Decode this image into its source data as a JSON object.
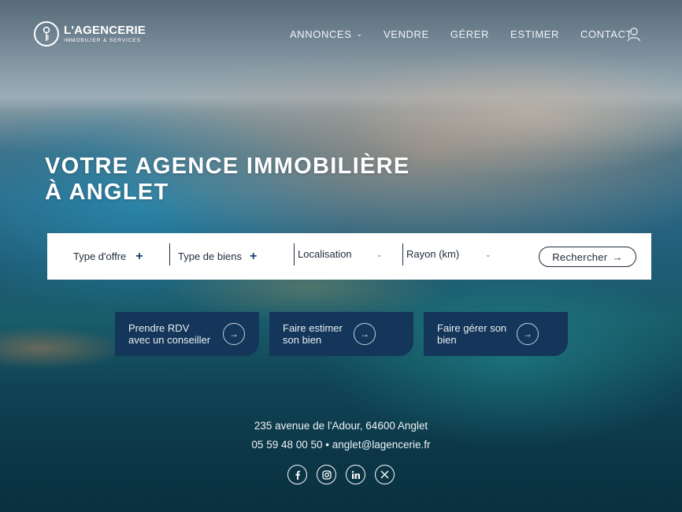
{
  "brand": {
    "name": "L'AGENCERIE",
    "tagline": "IMMOBILIER & SERVICES"
  },
  "nav": {
    "items": [
      {
        "label": "ANNONCES",
        "has_dropdown": true
      },
      {
        "label": "VENDRE"
      },
      {
        "label": "GÉRER"
      },
      {
        "label": "ESTIMER"
      },
      {
        "label": "CONTACT"
      }
    ],
    "account_icon": "user-icon"
  },
  "hero": {
    "title_line1": "VOTRE AGENCE IMMOBILIÈRE",
    "title_line2": "À ANGLET"
  },
  "search": {
    "offer_type": "Type d'offre",
    "property_type": "Type de biens",
    "location": "Localisation",
    "radius": "Rayon (km)",
    "submit_label": "Rechercher",
    "plus_icon": "+",
    "arrow": "→"
  },
  "cta": [
    {
      "line1": "Prendre RDV",
      "line2": "avec un conseiller"
    },
    {
      "line1": "Faire estimer",
      "line2": "son bien"
    },
    {
      "line1": "Faire gérer son",
      "line2": "bien"
    }
  ],
  "footer": {
    "address": "235 avenue de l'Adour, 64600 Anglet",
    "phone": "05 59 48 00 50",
    "separator": "•",
    "email": "anglet@lagencerie.fr",
    "socials": [
      "facebook-icon",
      "instagram-icon",
      "linkedin-icon",
      "x-icon"
    ]
  },
  "colors": {
    "navy": "#14365a",
    "text_dark": "#1e2b3a",
    "white": "#ffffff"
  }
}
